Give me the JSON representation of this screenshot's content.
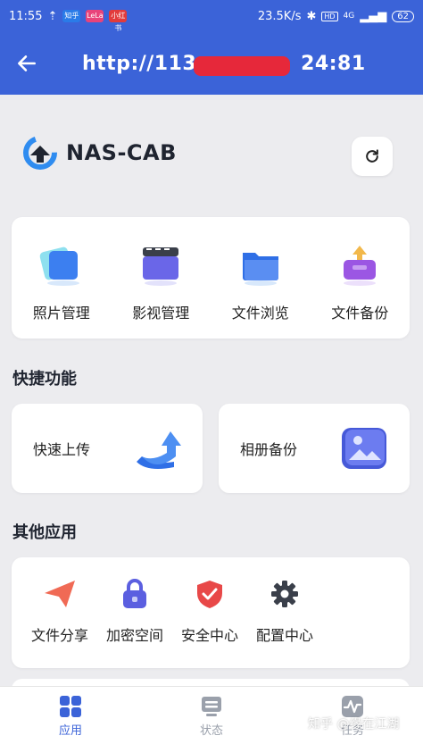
{
  "statusbar": {
    "time": "11:55",
    "apps": [
      "知乎",
      "LeLa",
      "小红书"
    ],
    "speed": "23.5K/s",
    "hd": "HD",
    "network": "4G",
    "battery": "62"
  },
  "appbar": {
    "url_prefix": "http://113.",
    "url_suffix": "24:81"
  },
  "brand": {
    "name": "NAS-CAB"
  },
  "apps": [
    {
      "label": "照片管理",
      "icon": "photos-icon"
    },
    {
      "label": "影视管理",
      "icon": "video-icon"
    },
    {
      "label": "文件浏览",
      "icon": "folder-icon"
    },
    {
      "label": "文件备份",
      "icon": "backup-box-icon"
    }
  ],
  "quick": {
    "title": "快捷功能",
    "items": [
      {
        "label": "快速上传",
        "icon": "upload-arrow-icon"
      },
      {
        "label": "相册备份",
        "icon": "album-image-icon"
      }
    ]
  },
  "other": {
    "title": "其他应用",
    "items": [
      {
        "label": "文件分享",
        "icon": "paper-plane-icon",
        "color": "#f06a55"
      },
      {
        "label": "加密空间",
        "icon": "lock-icon",
        "color": "#5b5fe0"
      },
      {
        "label": "安全中心",
        "icon": "shield-check-icon",
        "color": "#e84848"
      },
      {
        "label": "配置中心",
        "icon": "gear-icon",
        "color": "#3a3f4a"
      }
    ]
  },
  "nav": [
    {
      "label": "应用",
      "icon": "grid-icon",
      "active": true
    },
    {
      "label": "状态",
      "icon": "monitor-icon",
      "active": false
    },
    {
      "label": "任务",
      "icon": "activity-icon",
      "active": false
    }
  ],
  "watermark": "知乎 @缘在江湖",
  "colors": {
    "primary": "#3b63d8",
    "background": "#ececef",
    "inactive": "#9aa0ab"
  }
}
